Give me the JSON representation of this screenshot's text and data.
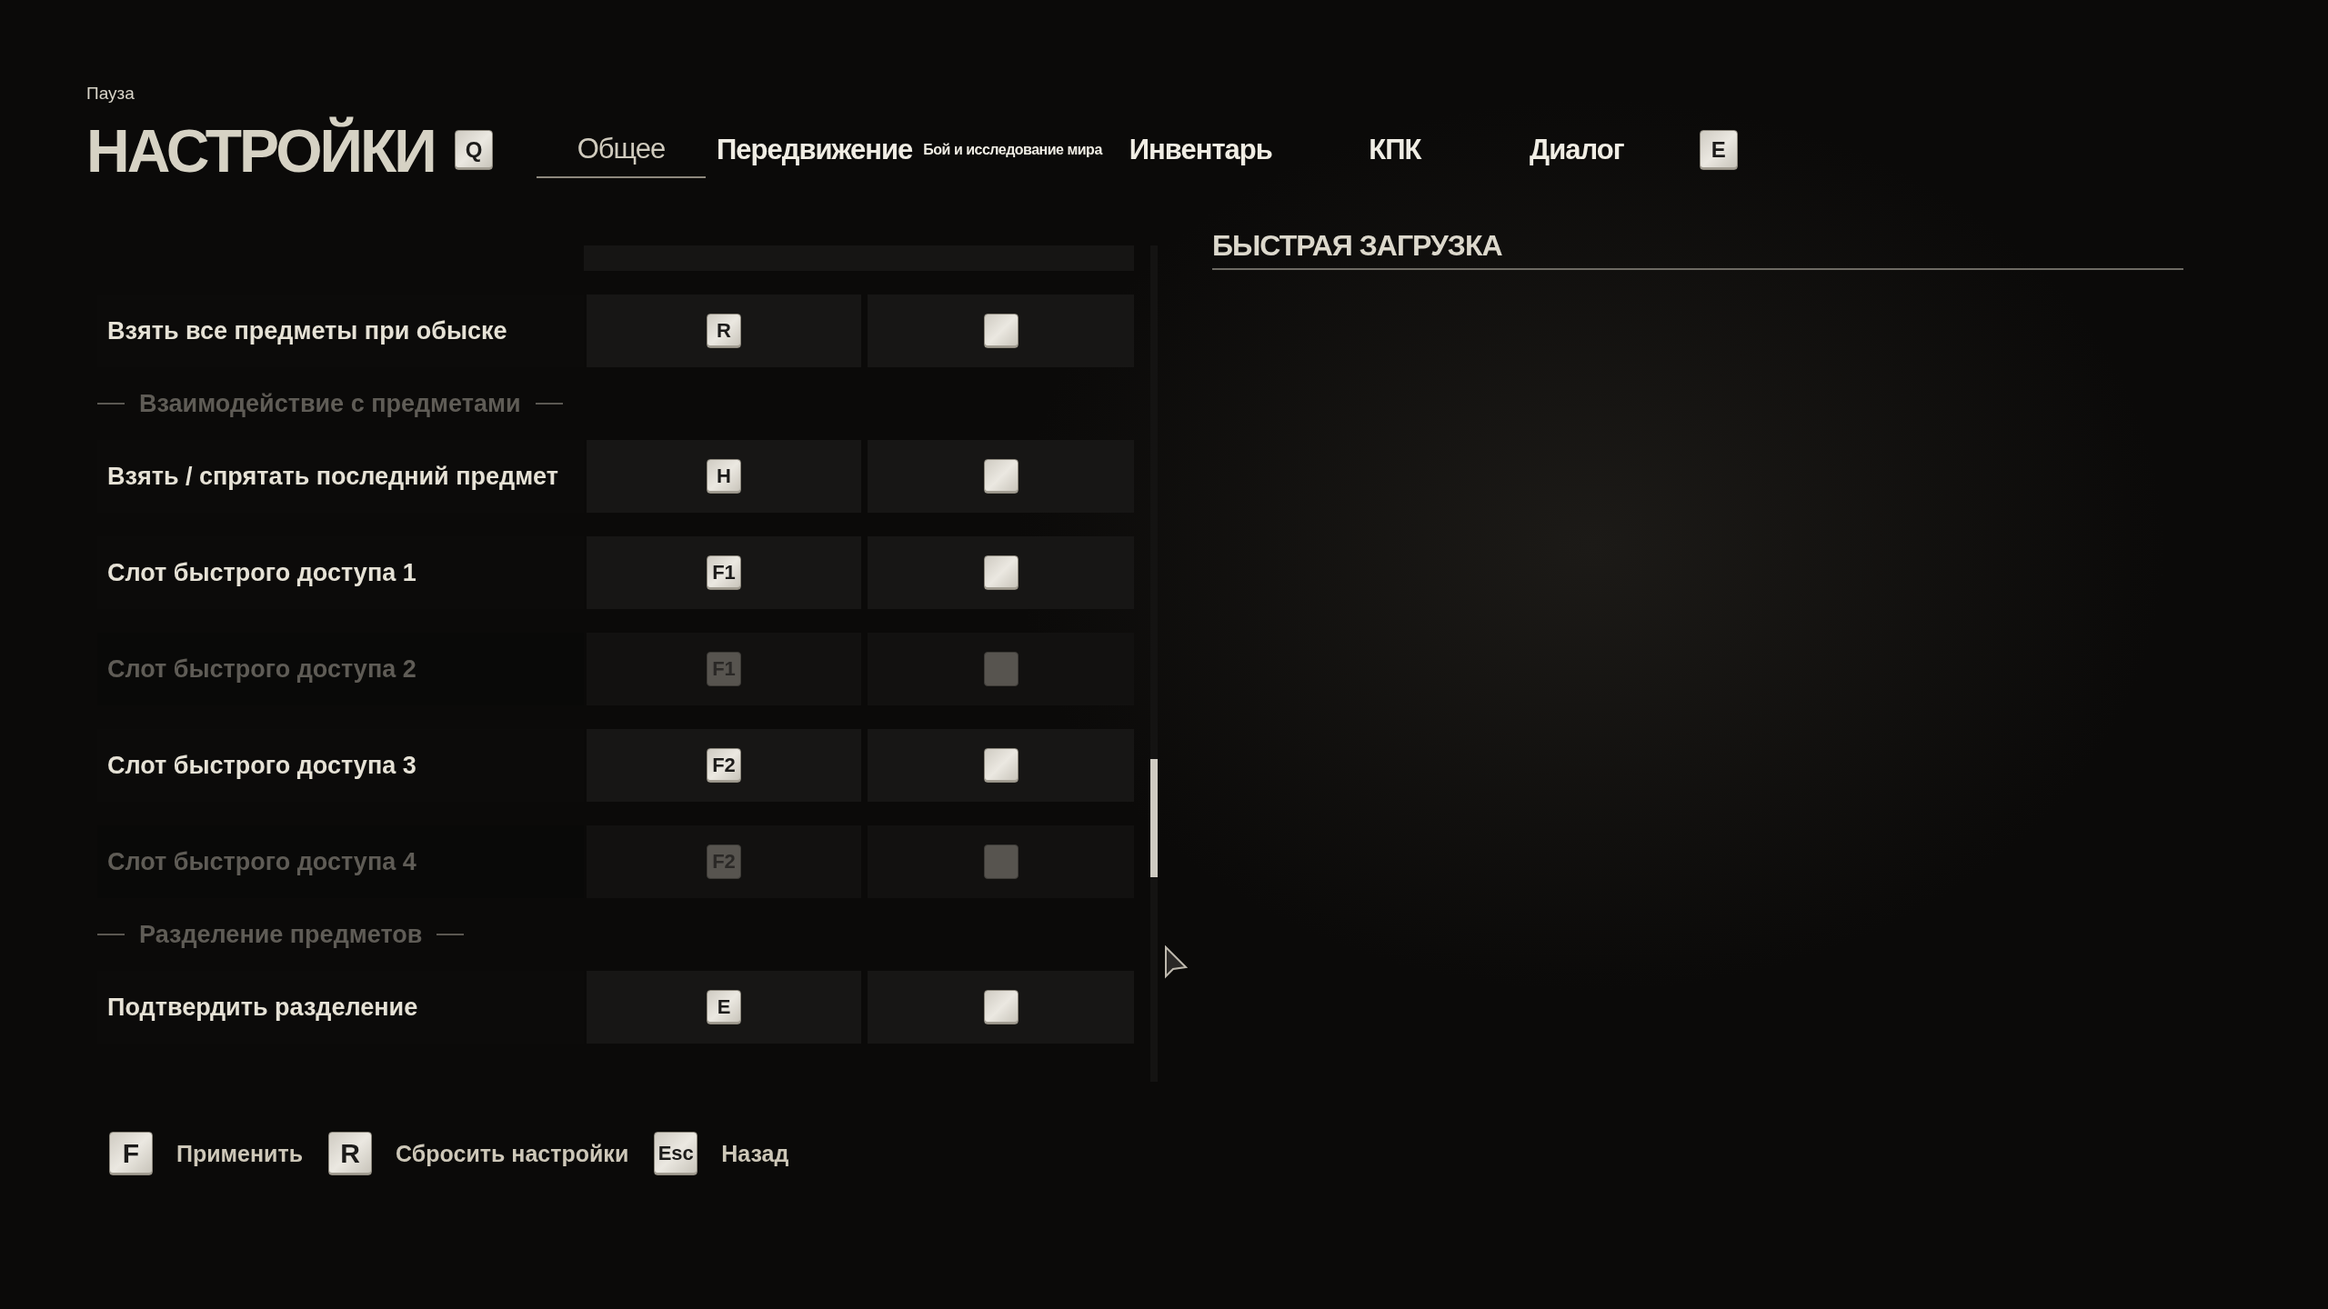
{
  "header": {
    "breadcrumb": "Пауза",
    "title": "НАСТРОЙКИ"
  },
  "tabs": {
    "prev_key": "Q",
    "next_key": "E",
    "items": [
      {
        "label": "Общее",
        "selected": true,
        "kind": "tab"
      },
      {
        "label": "Передвижение",
        "selected": false,
        "kind": "tab"
      },
      {
        "label": "Бой и исследование мира",
        "selected": false,
        "kind": "small"
      },
      {
        "label": "Инвентарь",
        "selected": false,
        "kind": "tab"
      },
      {
        "label": "КПК",
        "selected": false,
        "kind": "tab"
      },
      {
        "label": "Диалог",
        "selected": false,
        "kind": "tab"
      }
    ]
  },
  "bindings": [
    {
      "kind": "row",
      "label": "Взять все предметы при обыске",
      "primary": "R",
      "disabled": false
    },
    {
      "kind": "section",
      "label": "Взаимодействие с предметами"
    },
    {
      "kind": "row",
      "label": "Взять / спрятать последний предмет",
      "primary": "H",
      "disabled": false
    },
    {
      "kind": "row",
      "label": "Слот быстрого доступа 1",
      "primary": "F1",
      "disabled": false
    },
    {
      "kind": "row",
      "label": "Слот быстрого доступа 2",
      "primary": "F1",
      "disabled": true
    },
    {
      "kind": "row",
      "label": "Слот быстрого доступа 3",
      "primary": "F2",
      "disabled": false
    },
    {
      "kind": "row",
      "label": "Слот быстрого доступа 4",
      "primary": "F2",
      "disabled": true
    },
    {
      "kind": "section",
      "label": "Разделение предметов"
    },
    {
      "kind": "row",
      "label": "Подтвердить разделение",
      "primary": "E",
      "disabled": false
    }
  ],
  "detail": {
    "title": "БЫСТРАЯ ЗАГРУЗКА"
  },
  "footer": [
    {
      "key": "F",
      "label": "Применить"
    },
    {
      "key": "R",
      "label": "Сбросить настройки"
    },
    {
      "key": "Esc",
      "label": "Назад"
    }
  ]
}
